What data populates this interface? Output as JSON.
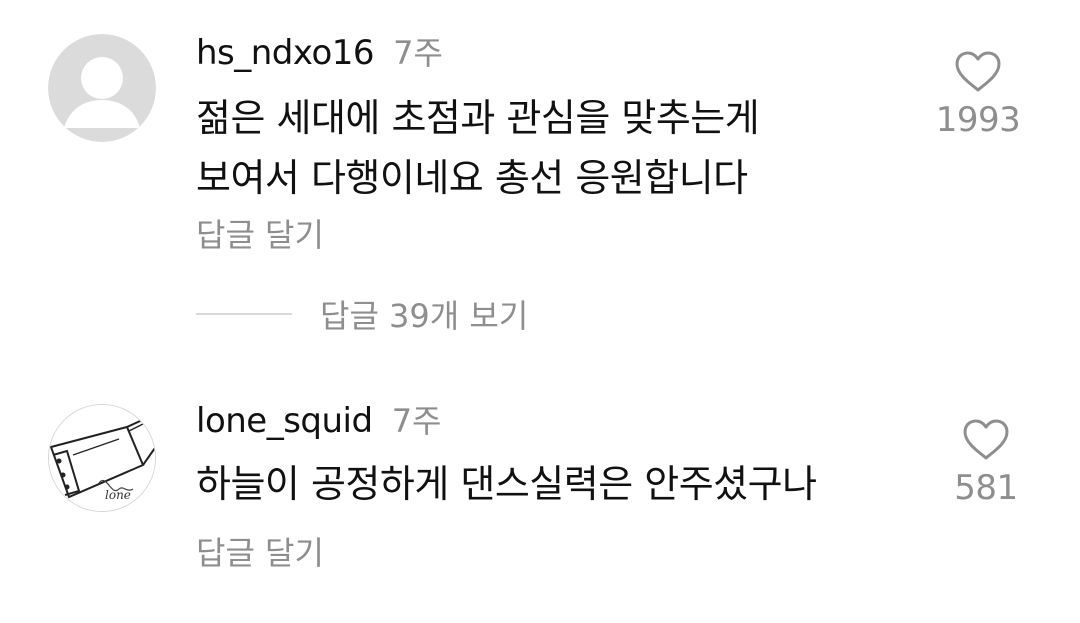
{
  "comments": [
    {
      "username": "hs_ndxo16",
      "time": "7주",
      "text_lines": [
        "젊은 세대에 초점과 관심을 맞추는게",
        "보여서 다행이네요 총선 응원합니다"
      ],
      "reply_label": "답글 달기",
      "like_count": "1993",
      "avatar_icon": "default-profile-icon",
      "view_replies_label": "답글 39개 보기"
    },
    {
      "username": "lone_squid",
      "time": "7주",
      "text_lines": [
        "하늘이 공정하게 댄스실력은 안주셨구나"
      ],
      "reply_label": "답글 달기",
      "like_count": "581",
      "avatar_icon": "sketch-drawing-avatar",
      "avatar_signature": "lone"
    }
  ],
  "icons": {
    "like": "heart-outline-icon"
  },
  "colors": {
    "text_primary": "#111111",
    "text_secondary": "#8e8e8e",
    "divider": "#d9d9d9",
    "avatar_placeholder": "#dbdbdb"
  }
}
